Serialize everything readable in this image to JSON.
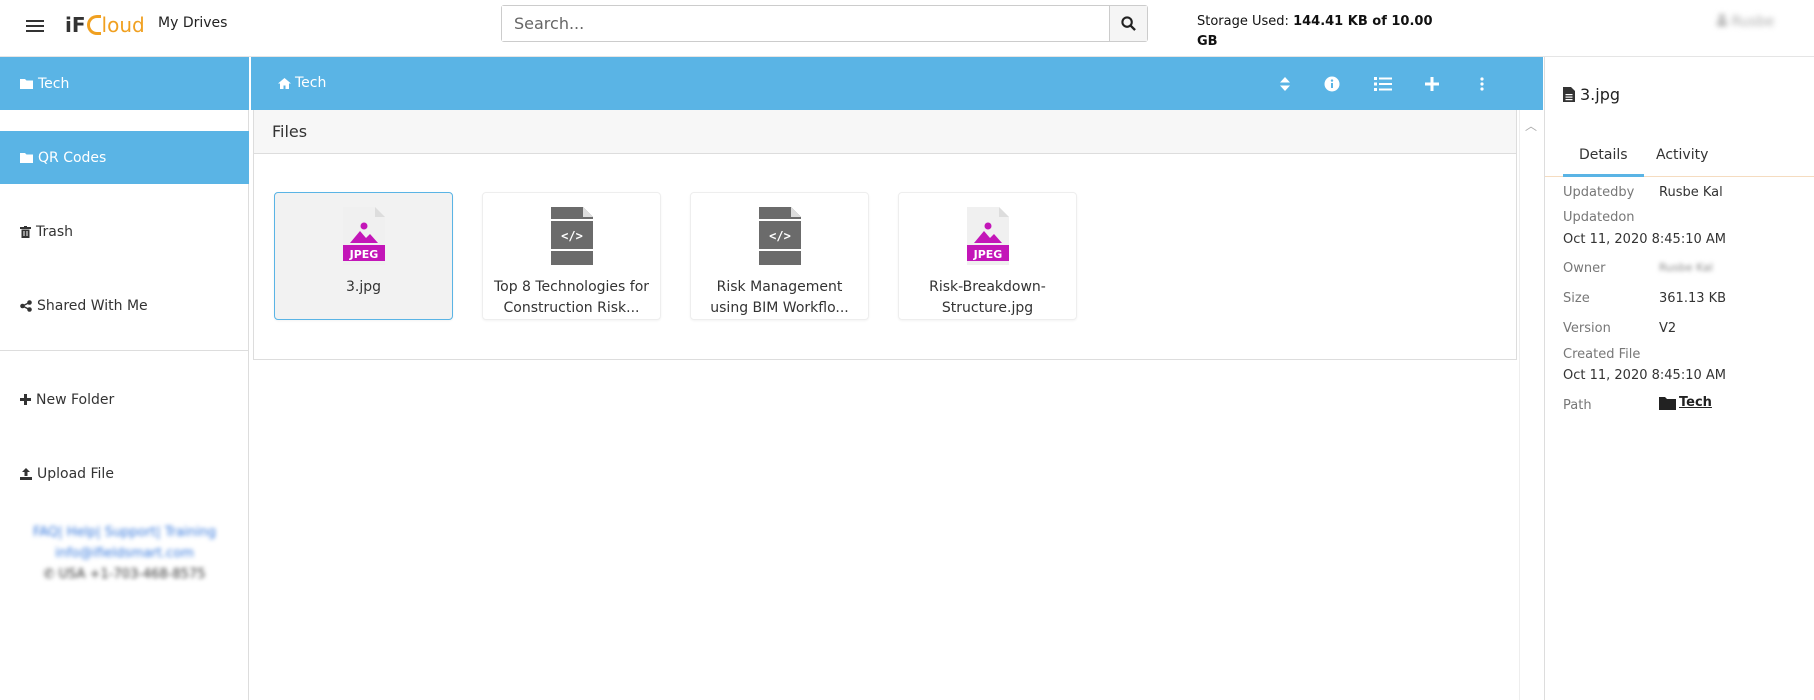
{
  "header": {
    "logo_if": "iF",
    "logo_cloud": "loud",
    "nav_label": "My Drives",
    "search_placeholder": "Search...",
    "storage_label": "Storage Used:",
    "storage_value": "144.41 KB of 10.00 GB",
    "user_name": "Rusbe"
  },
  "sidebar": {
    "items": [
      {
        "label": "Tech",
        "icon": "folder-icon"
      },
      {
        "label": "QR Codes",
        "icon": "folder-icon"
      },
      {
        "label": "Trash",
        "icon": "trash-icon"
      },
      {
        "label": "Shared With Me",
        "icon": "share-icon"
      },
      {
        "label": "New Folder",
        "icon": "plus-icon"
      },
      {
        "label": "Upload File",
        "icon": "upload-icon"
      }
    ],
    "footer_links": "FAQ| Help| Support| Training",
    "footer_email": "info@ifieldsmart.com",
    "footer_phone": "USA  +1-703-468-8575"
  },
  "main": {
    "breadcrumb": "Tech",
    "section_title": "Files",
    "files": [
      {
        "name": "3.jpg",
        "type": "jpeg"
      },
      {
        "name": "Top 8 Technologies for Construction Risk...",
        "type": "code"
      },
      {
        "name": "Risk Management using BIM Workflo...",
        "type": "code"
      },
      {
        "name": "Risk-Breakdown-Structure.jpg",
        "type": "jpeg"
      }
    ],
    "file_badge": "JPEG"
  },
  "details": {
    "title": "3.jpg",
    "tabs": [
      "Details",
      "Activity"
    ],
    "updatedby_label": "Updatedby",
    "updatedby_value": "Rusbe Kal",
    "updatedon_label": "Updatedon",
    "updatedon_value": "Oct 11, 2020 8:45:10 AM",
    "owner_label": "Owner",
    "owner_value": "Rusbe Kal",
    "size_label": "Size",
    "size_value": "361.13 KB",
    "version_label": "Version",
    "version_value": "V2",
    "created_label": "Created File",
    "created_value": "Oct 11, 2020 8:45:10 AM",
    "path_label": "Path",
    "path_value": "Tech"
  },
  "colors": {
    "accent": "#5ab4e5",
    "jpeg": "#c316b8",
    "code": "#6b6b6b",
    "logo_orange": "#f0a020"
  }
}
